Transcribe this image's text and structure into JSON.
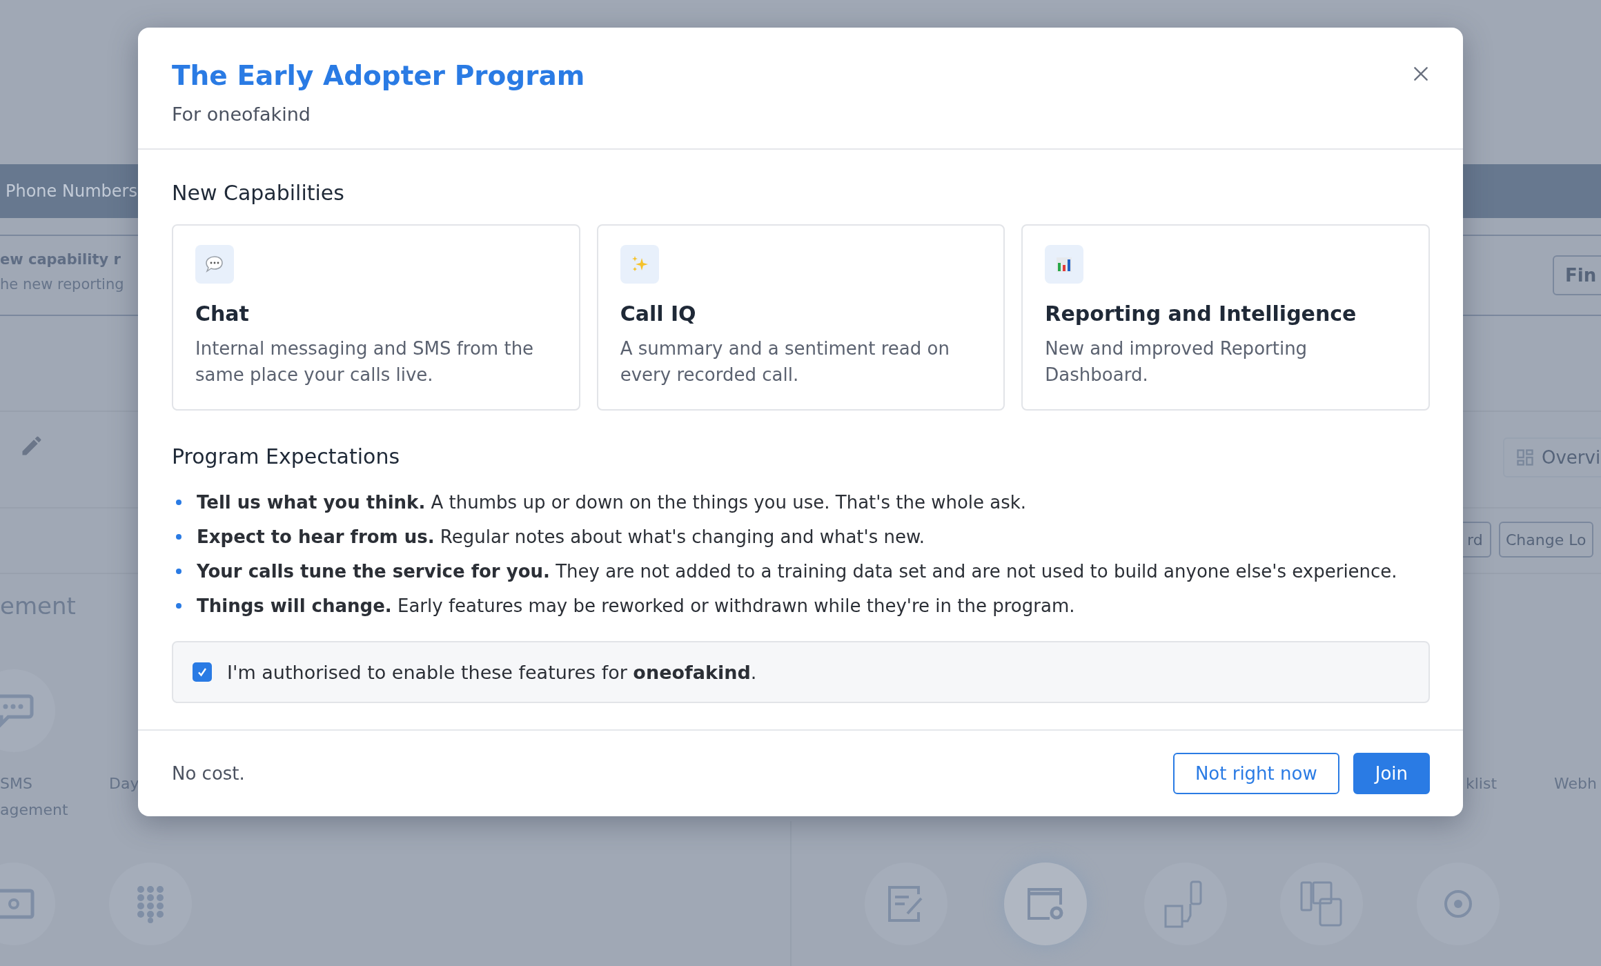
{
  "background": {
    "tab_bar": {
      "label": "Phone Numbers"
    },
    "notice": {
      "title": "ew capability r",
      "text": "he new reporting"
    },
    "find_button": "Fin",
    "overview_button": "Overvi",
    "buttons": [
      "rd",
      "Change Lo"
    ],
    "section_title": "ement",
    "tiles": [
      {
        "lines": [
          "SMS",
          "agement"
        ]
      },
      {
        "lines": [
          "Day"
        ]
      },
      {
        "lines": [
          "klist"
        ]
      },
      {
        "lines": [
          "Webh"
        ]
      }
    ]
  },
  "modal": {
    "title": "The Early Adopter Program",
    "subtitle": "For oneofakind",
    "capabilities_heading": "New Capabilities",
    "capabilities": [
      {
        "kind": "chat",
        "title": "Chat",
        "description": "Internal messaging and SMS from the same place your calls live."
      },
      {
        "kind": "sparkle",
        "title": "Call IQ",
        "description": "A summary and a sentiment read on every recorded call."
      },
      {
        "kind": "chart",
        "title": "Reporting and Intelligence",
        "description": "New and improved Reporting Dashboard."
      }
    ],
    "expectations_heading": "Program Expectations",
    "expectations": [
      "**Tell us what you think.** A thumbs up or down on the things you use. That's the whole ask.",
      "**Expect to hear from us.** Regular notes about what's changing and what's new.",
      "**Your calls tune the service for you.** They are not added to a training data set and are not used to build anyone else's experience.",
      "**Things will change.** Early features may be reworked or withdrawn while they're in the program."
    ],
    "consent": {
      "label": "I'm authorised to enable these features for **oneofakind**.",
      "checked": true
    },
    "footer_note": "No cost.",
    "buttons": [
      {
        "kind": "secondary",
        "label": "Not right now"
      },
      {
        "kind": "primary",
        "label": "Join"
      }
    ]
  }
}
